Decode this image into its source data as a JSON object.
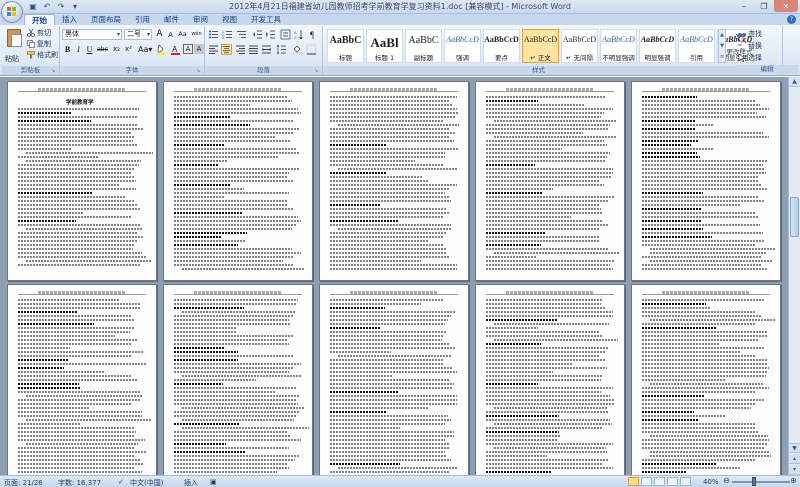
{
  "window": {
    "title": "2012年4月21日福建省幼儿园教师招考学前教育学复习资料1.doc [兼容模式] - Microsoft Word"
  },
  "tabs": [
    "开始",
    "插入",
    "页面布局",
    "引用",
    "邮件",
    "审阅",
    "视图",
    "开发工具"
  ],
  "clipboard": {
    "paste_label": "粘贴",
    "cut_label": "剪切",
    "copy_label": "复制",
    "format_painter_label": "格式刷",
    "group_label": "剪贴板"
  },
  "font": {
    "name": "黑体",
    "size": "二号",
    "group_label": "字体",
    "bold": "B",
    "italic": "I",
    "underline": "U",
    "strike": "abc",
    "subscript": "x₂",
    "superscript": "x²",
    "clear": "Aa",
    "grow": "A",
    "shrink": "A",
    "phonetic": "wén",
    "char_border": "A",
    "char_shading": "A",
    "highlight_color": "#ffff00",
    "font_color": "#e02020"
  },
  "paragraph": {
    "group_label": "段落"
  },
  "styles": {
    "group_label": "样式",
    "cards": [
      {
        "sample": "AaBbC",
        "name": "标题",
        "size": "10px",
        "bold": true
      },
      {
        "sample": "AaBl",
        "name": "标题 1",
        "size": "13px",
        "bold": true
      },
      {
        "sample": "AaBbC",
        "name": "副标题",
        "size": "10px",
        "bold": false
      },
      {
        "sample": "AaBbCcD",
        "name": "强调",
        "size": "8px",
        "bold": false,
        "italic": true
      },
      {
        "sample": "AaBbCcD",
        "name": "要点",
        "size": "8px",
        "bold": true
      },
      {
        "sample": "AaBbCcD",
        "name": "↵ 正文",
        "size": "8px",
        "bold": false,
        "active": true
      },
      {
        "sample": "AaBbCcD",
        "name": "↵ 无间隔",
        "size": "8px",
        "bold": false
      },
      {
        "sample": "AaBbCcD",
        "name": "不明显强调",
        "size": "8px",
        "bold": false,
        "italic": true
      },
      {
        "sample": "AaBbCcD",
        "name": "明显强调",
        "size": "8px",
        "bold": true,
        "italic": true
      },
      {
        "sample": "AaBbCcD",
        "name": "引用",
        "size": "8px",
        "bold": false,
        "italic": true
      },
      {
        "sample": "AaBbCcD",
        "name": "明显引用",
        "size": "8px",
        "bold": true,
        "italic": true
      }
    ],
    "change_styles_label": "更改样式"
  },
  "editing": {
    "group_label": "编辑",
    "find_label": "查找",
    "replace_label": "替换",
    "select_label": "选择"
  },
  "document": {
    "page1_title": "学前教育学"
  },
  "status": {
    "page": "页面: 21/26",
    "words": "字数: 16,377",
    "language": "中文(中国)",
    "mode": "插入",
    "zoom": "40%"
  }
}
